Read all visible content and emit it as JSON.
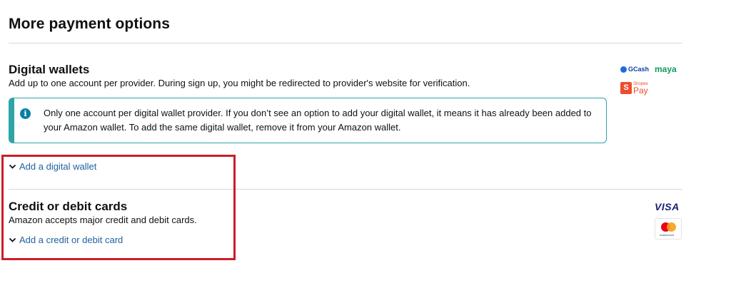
{
  "page": {
    "title": "More payment options"
  },
  "digital_wallets": {
    "title": "Digital wallets",
    "description": "Add up to one account per provider. During sign up, you might be redirected to provider's website for verification.",
    "alert_text": "Only one account per digital wallet provider. If you don’t see an option to add your digital wallet, it means it has already been added to your Amazon wallet. To add the same digital wallet, remove it from your Amazon wallet.",
    "add_link": "Add a digital wallet",
    "logos": {
      "gcash": "GCash",
      "maya": "maya",
      "shopee_small": "Shopee",
      "shopee_pay": "Pay"
    }
  },
  "cards": {
    "title": "Credit or debit cards",
    "description": "Amazon accepts major credit and debit cards.",
    "add_link": "Add a credit or debit card",
    "logos": {
      "visa": "VISA",
      "mastercard": "mastercard"
    }
  },
  "colors": {
    "link": "#2162a1",
    "alert_border": "#2ea4a6",
    "highlight": "#cc1d28",
    "info_icon": "#0a7ea8"
  },
  "icons": {
    "info": "info-icon",
    "expand": "chevron-down-icon"
  }
}
